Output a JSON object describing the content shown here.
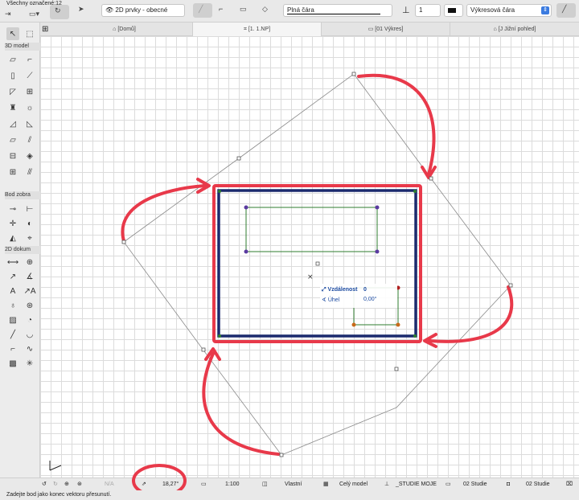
{
  "toolbar": {
    "selection_count": "Všechny označené:12",
    "layer_combo": "2D prvky - obecné",
    "line_type": "Plná čára",
    "pen_number": "1",
    "line_category": "Výkresová čára"
  },
  "tabs": [
    {
      "label": "[Domů]"
    },
    {
      "label": "[1. 1.NP]"
    },
    {
      "label": "[01 Výkres]"
    },
    {
      "label": "[J Jižní pohled]"
    }
  ],
  "palette": {
    "sections": [
      "3D model",
      "Bod zobra",
      "2D dokum"
    ]
  },
  "tracker": {
    "distance_label": "Vzdálenost",
    "distance_value": "0",
    "angle_label": "Úhel",
    "angle_value": "0,00°"
  },
  "status": {
    "na": "N/A",
    "angle": "18,27°",
    "scale": "1:100",
    "structure": "Vlastní",
    "model_view": "Celý model",
    "renovation": "_STUDIE MOJE",
    "pen_set": "02 Studie",
    "view_set": "02 Studie"
  },
  "hint": "Zadejte bod jako konec vektoru přesunutí.",
  "colors": {
    "annotation_red": "#e8394a",
    "wall_blue": "#1b2a6e",
    "green_rect": "#2f7d2f"
  }
}
